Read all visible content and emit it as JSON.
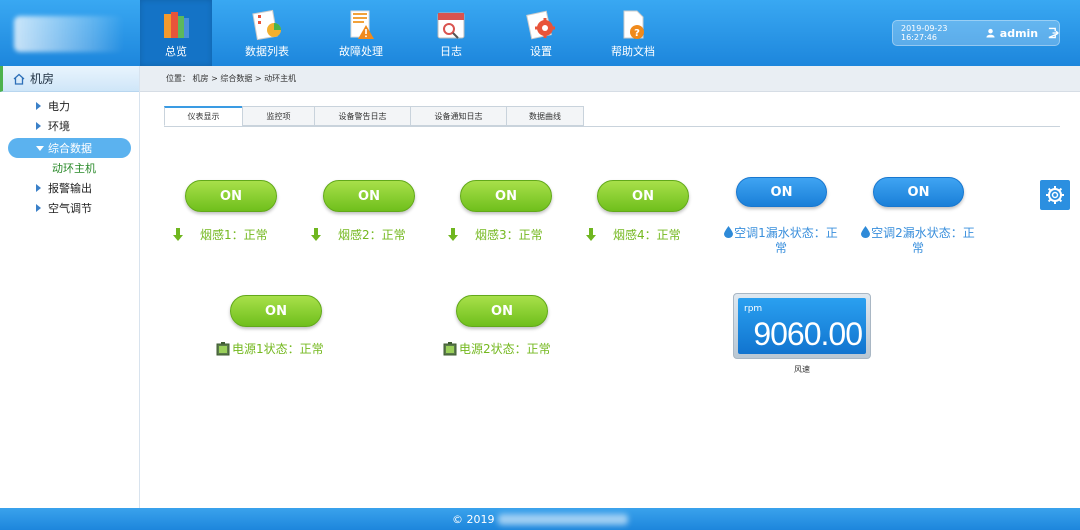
{
  "header": {
    "nav": [
      {
        "label": "总览",
        "icon": "books-icon",
        "active": true
      },
      {
        "label": "数据列表",
        "icon": "chart-list-icon"
      },
      {
        "label": "故障处理",
        "icon": "warning-doc-icon"
      },
      {
        "label": "日志",
        "icon": "calendar-log-icon"
      },
      {
        "label": "设置",
        "icon": "settings-gear-icon"
      },
      {
        "label": "帮助文档",
        "icon": "help-doc-icon"
      }
    ],
    "user": {
      "datetime": "2019-09-23  16:27:46",
      "name": "admin"
    }
  },
  "sidebar": {
    "title": "机房",
    "items": [
      {
        "label": "电力"
      },
      {
        "label": "环境"
      },
      {
        "label": "综合数据",
        "active": true
      },
      {
        "label": "报警输出"
      },
      {
        "label": "空气调节"
      }
    ],
    "subitem": "动环主机"
  },
  "breadcrumb": "位置：  机房 > 综合数据 > 动环主机",
  "tabs": [
    "仪表显示",
    "监控项",
    "设备警告日志",
    "设备通知日志",
    "数据曲线"
  ],
  "switches": [
    {
      "button": "ON",
      "status": "烟感1：正常"
    },
    {
      "button": "ON",
      "status": "烟感2：正常"
    },
    {
      "button": "ON",
      "status": "烟感3：正常"
    },
    {
      "button": "ON",
      "status": "烟感4：正常"
    },
    {
      "button": "ON",
      "status": "空调1漏水状态：正常"
    },
    {
      "button": "ON",
      "status": "空调2漏水状态：正常"
    },
    {
      "button": "ON",
      "status": "电源1状态：正常"
    },
    {
      "button": "ON",
      "status": "电源2状态：正常"
    }
  ],
  "gauge": {
    "unit": "rpm",
    "value": "9060.00",
    "label": "风速"
  },
  "footer": {
    "copyright": "© 2019"
  },
  "colors": {
    "accent": "#1d86dc",
    "on_green": "#7ec427",
    "status_green": "#74b81f",
    "status_blue": "#3a8fdc"
  }
}
